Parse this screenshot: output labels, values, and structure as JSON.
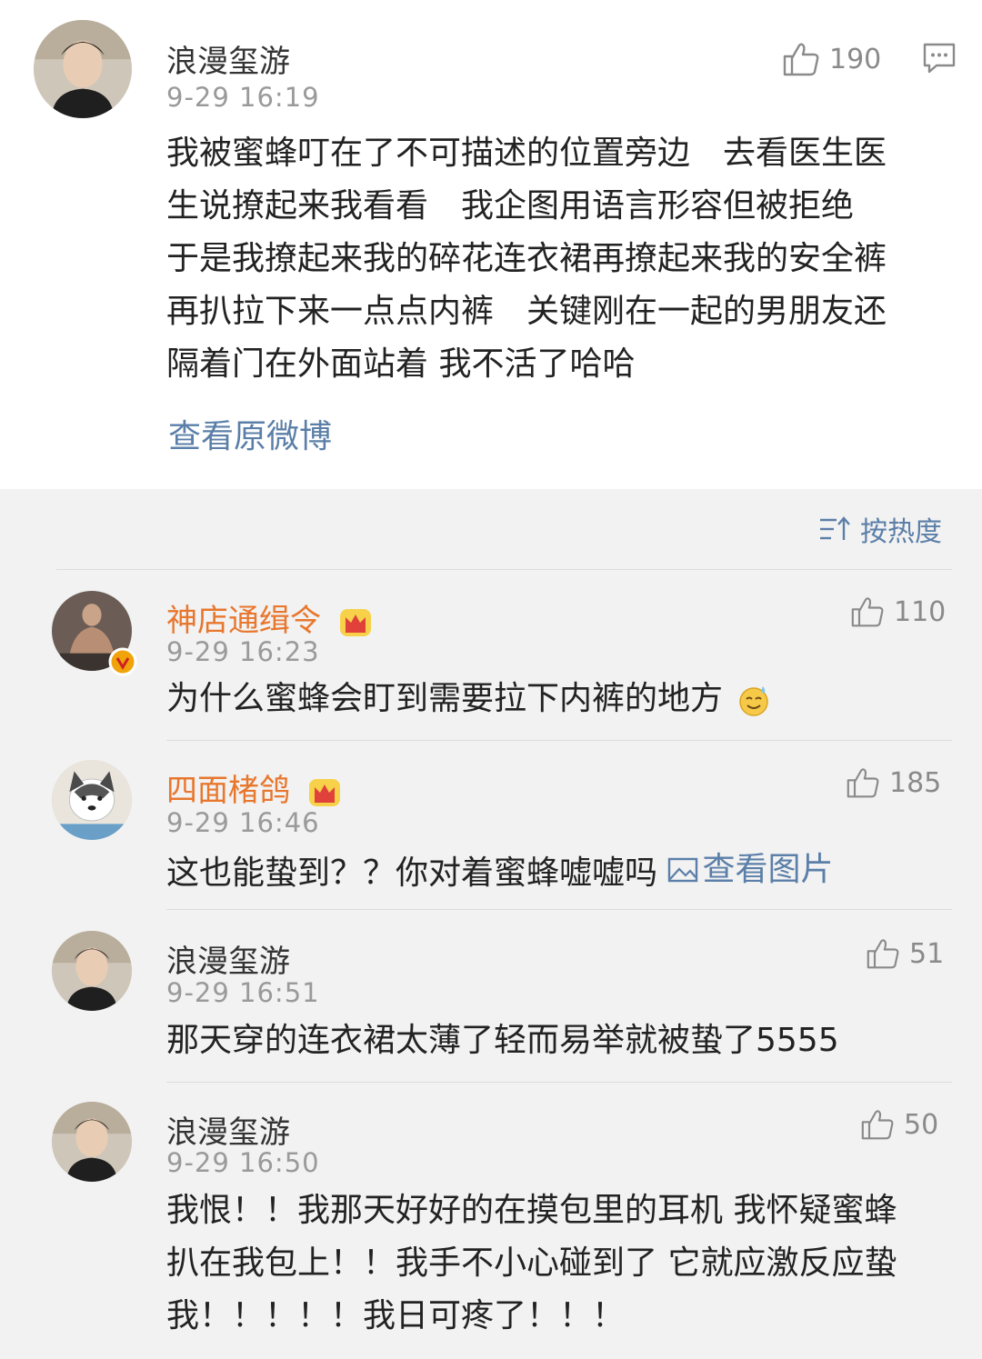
{
  "main_post": {
    "author": "浪漫玺游",
    "time": "9-29 16:19",
    "likes": "190",
    "lines": [
      "我被蜜蜂叮在了不可描述的位置旁边　去看医生医",
      "生说撩起来我看看　我企图用语言形容但被拒绝",
      "于是我撩起来我的碎花连衣裙再撩起来我的安全裤",
      "再扒拉下来一点点内裤　关键刚在一起的男朋友还",
      "隔着门在外面站着 我不活了哈哈"
    ],
    "view_original": "查看原微博"
  },
  "sort": {
    "label": "按热度"
  },
  "comments": [
    {
      "author": "神店通缉令",
      "time": "9-29 16:23",
      "likes": "110",
      "text": "为什么蜜蜂会盯到需要拉下内裤的地方"
    },
    {
      "author": "四面楮鸽",
      "time": "9-29 16:46",
      "likes": "185",
      "text": "这也能蛰到？？你对着蜜蜂嘘嘘吗",
      "link": "查看图片"
    },
    {
      "author": "浪漫玺游",
      "time": "9-29 16:51",
      "likes": "51",
      "text": "那天穿的连衣裙太薄了轻而易举就被蛰了5555"
    },
    {
      "author": "浪漫玺游",
      "time": "9-29 16:50",
      "likes": "50",
      "lines": [
        "我恨！！我那天好好的在摸包里的耳机 我怀疑蜜蜂",
        "扒在我包上！！我手不小心碰到了 它就应激反应蛰",
        "我！！！！！我日可疼了！！！"
      ]
    }
  ],
  "colors": {
    "vip_name": "#e8772e",
    "link": "#5b7fa8",
    "meta": "#9a9a9a",
    "background": "#f2f2f2"
  },
  "icons": [
    "thumb-up-icon",
    "comment-icon",
    "sort-icon",
    "crown-icon",
    "verified-icon",
    "image-icon",
    "emoji-sweat-icon"
  ]
}
